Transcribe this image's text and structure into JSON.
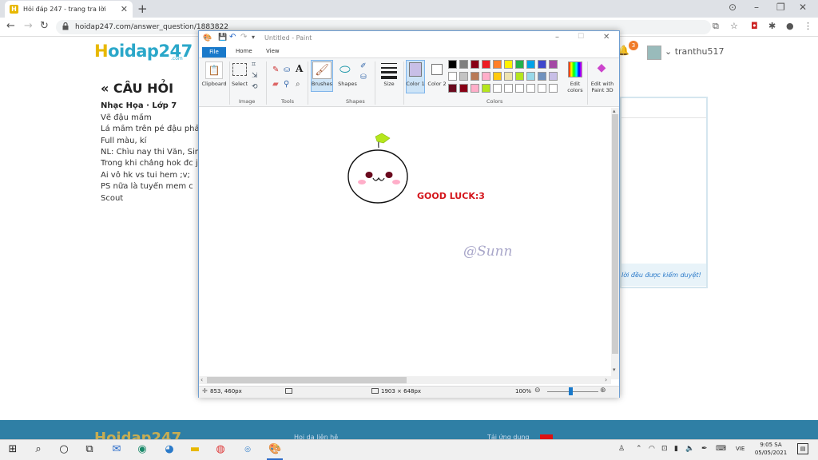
{
  "browser": {
    "tab_title": "Hỏi đáp 247 - trang tra lời",
    "tab_favicon": "H",
    "url": "hoidap247.com/answer_question/1883822"
  },
  "site": {
    "logo_main": "oidap247",
    "logo_h": "H",
    "logo_sub": ".com",
    "notif_count": "3",
    "help_label": "?",
    "username": "tranthu517",
    "question_heading": "« CÂU HỎI",
    "question_subject": "Nhạc Họa · Lớp 7",
    "question_lines": [
      "Vẽ đậu mầm",
      "Lá mầm trên pé đậu phải l",
      "Full màu, kí",
      "NL: Chìu nay thi Văn, Sinh",
      "Trong khi chẳng hok đc j c",
      "Ai vô hk vs tui hem ;v;",
      "PS nữa là tuyển mem c",
      "Scout"
    ],
    "answer_note": "lời đều được kiểm duyệt!",
    "footer_logo": "Hoidap247",
    "footer_text1": "Hoi da liên hệ",
    "footer_text2": "Tải ứng dụng"
  },
  "paint": {
    "window_title": "Untitled - Paint",
    "tabs": {
      "file": "File",
      "home": "Home",
      "view": "View"
    },
    "buttons": {
      "clipboard": "Clipboard",
      "select": "Select",
      "brushes": "Brushes",
      "shapes": "Shapes",
      "size": "Size",
      "color1": "Color 1",
      "color2": "Color 2",
      "edit_colors": "Edit colors",
      "edit_paint3d": "Edit with Paint 3D"
    },
    "groups": {
      "image": "Image",
      "tools": "Tools",
      "shapes": "Shapes",
      "colors": "Colors"
    },
    "text_tool": "A",
    "palette": [
      "#000000",
      "#7f7f7f",
      "#880015",
      "#ed1c24",
      "#ff7f27",
      "#fff200",
      "#22b14c",
      "#00a2e8",
      "#3f48cc",
      "#a349a4",
      "#ffffff",
      "#c3c3c3",
      "#b97a57",
      "#ffaec9",
      "#ffc90e",
      "#efe4b0",
      "#b5e61d",
      "#99d9ea",
      "#7092be",
      "#c8bfe7",
      "#6a0a1e",
      "#880015",
      "#ffaec9",
      "#b5e61d",
      "#ffffff",
      "#ffffff",
      "#ffffff",
      "#ffffff",
      "#ffffff",
      "#ffffff"
    ],
    "color1": "#c8bfe7",
    "color2": "#ffffff",
    "drawing": {
      "good_luck_text": "GOOD LUCK:3",
      "signature": "@Sunn",
      "face": "•ω•"
    },
    "status": {
      "cursor_pos": "853, 460px",
      "canvas_size": "1903 × 648px",
      "zoom": "100%"
    }
  },
  "taskbar": {
    "time": "9:05 SA",
    "date": "05/05/2021",
    "lang": "VIE"
  }
}
